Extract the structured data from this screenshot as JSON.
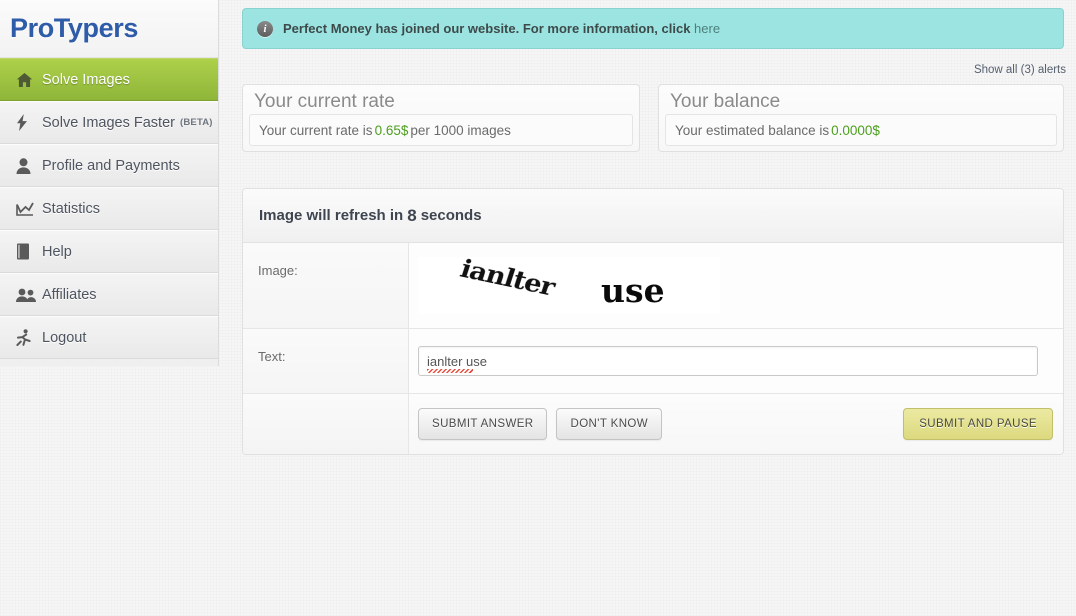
{
  "brand": {
    "logo": "ProTypers"
  },
  "sidebar": {
    "items": [
      {
        "label": "Solve Images",
        "icon": "home-icon",
        "active": true,
        "beta": ""
      },
      {
        "label": "Solve Images Faster",
        "icon": "bolt-icon",
        "active": false,
        "beta": "(BETA)"
      },
      {
        "label": "Profile and Payments",
        "icon": "user-icon",
        "active": false,
        "beta": ""
      },
      {
        "label": "Statistics",
        "icon": "chart-icon",
        "active": false,
        "beta": ""
      },
      {
        "label": "Help",
        "icon": "book-icon",
        "active": false,
        "beta": ""
      },
      {
        "label": "Affiliates",
        "icon": "users-icon",
        "active": false,
        "beta": ""
      },
      {
        "label": "Logout",
        "icon": "running-person-icon",
        "active": false,
        "beta": ""
      }
    ]
  },
  "alert": {
    "icon": "info-icon",
    "icon_glyph": "i",
    "message": "Perfect Money has joined our website. For more information, click",
    "link_label": "here",
    "show_all_label": "Show all (3) alerts",
    "background_color": "#9ce4e1"
  },
  "rate_panel": {
    "title": "Your current rate",
    "text_before": "Your current rate is",
    "value": "0.65$",
    "text_after": "per 1000 images"
  },
  "balance_panel": {
    "title": "Your balance",
    "text_before": "Your estimated balance is",
    "value": "0.0000$",
    "text_after": ""
  },
  "captcha": {
    "header_before": "Image will refresh in",
    "seconds": "8",
    "header_after": "seconds",
    "image_label": "Image:",
    "image_word_1": "ianlter",
    "image_word_2": "use",
    "text_label": "Text:",
    "answer_value": "ianlter use",
    "answer_placeholder": "",
    "buttons": {
      "submit": "SUBMIT ANSWER",
      "dont_know": "DON'T KNOW",
      "submit_pause": "SUBMIT AND PAUSE"
    }
  },
  "colors": {
    "accent_green": "#8fb63a",
    "value_green": "#4c9f1e",
    "brand_blue": "#2f5ca8",
    "alert_teal": "#9ce4e1",
    "pause_yellow": "#dcd97f"
  }
}
